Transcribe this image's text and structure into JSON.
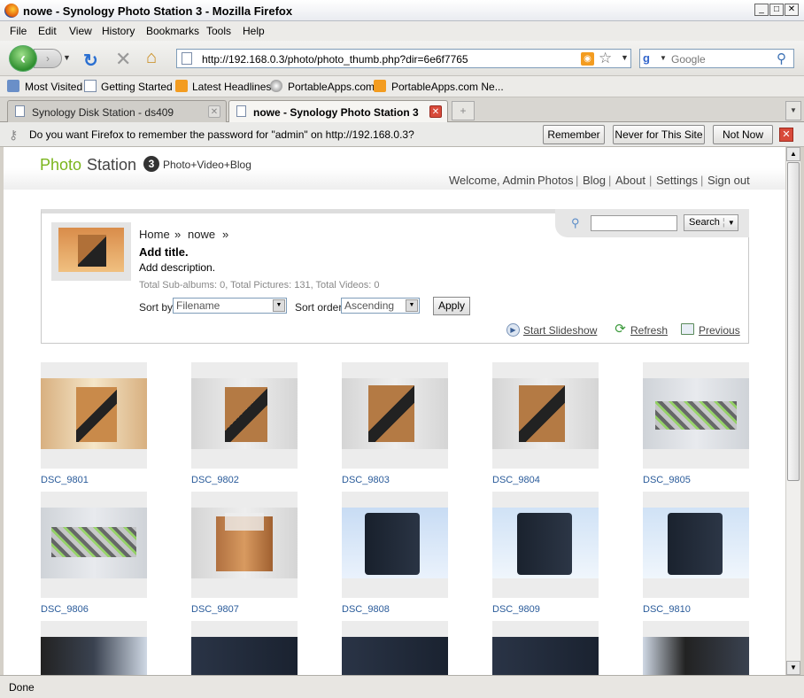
{
  "window": {
    "title": "nowe - Synology Photo Station 3 - Mozilla Firefox",
    "minimize": "_",
    "maximize": "□",
    "close": "✕"
  },
  "menu": [
    "File",
    "Edit",
    "View",
    "History",
    "Bookmarks",
    "Tools",
    "Help"
  ],
  "nav": {
    "url": "http://192.168.0.3/photo/photo_thumb.php?dir=6e6f7765",
    "search_placeholder": "Google"
  },
  "bookmarks": [
    "Most Visited",
    "Getting Started",
    "Latest Headlines",
    "PortableApps.com",
    "PortableApps.com Ne..."
  ],
  "tabs": [
    {
      "label": "Synology Disk Station - ds409"
    },
    {
      "label": "nowe - Synology Photo Station 3"
    }
  ],
  "notification": {
    "message": "Do you want Firefox to remember the password for \"admin\" on http://192.168.0.3?",
    "remember": "Remember",
    "never": "Never for This Site",
    "not_now": "Not Now"
  },
  "site": {
    "logo_photo": "Photo",
    "logo_station": "Station",
    "logo_version": "3",
    "logo_tagline": "Photo+Video+Blog",
    "nav_welcome": "Welcome, Admin",
    "nav_photos": "Photos",
    "nav_blog": "Blog",
    "nav_about": "About",
    "nav_settings": "Settings",
    "nav_signout": "Sign out",
    "search_button": "Search"
  },
  "album": {
    "crumb_home": "Home",
    "crumb_sep": "»",
    "crumb_album": "nowe",
    "title": "Add title.",
    "description": "Add description.",
    "totals": "Total Sub-albums: 0, Total Pictures: 131, Total Videos: 0",
    "sort_by_label": "Sort by",
    "sort_by_value": "Filename",
    "sort_order_label": "Sort order",
    "sort_order_value": "Ascending",
    "apply": "Apply",
    "slideshow": "Start Slideshow",
    "refresh": "Refresh",
    "previous": "Previous"
  },
  "photos": [
    {
      "name": "DSC_9801",
      "kind": "box-warm"
    },
    {
      "name": "DSC_9802",
      "kind": "box"
    },
    {
      "name": "DSC_9803",
      "kind": "box"
    },
    {
      "name": "DSC_9804",
      "kind": "box"
    },
    {
      "name": "DSC_9805",
      "kind": "cables"
    },
    {
      "name": "DSC_9806",
      "kind": "cables"
    },
    {
      "name": "DSC_9807",
      "kind": "packing"
    },
    {
      "name": "DSC_9808",
      "kind": "nas"
    },
    {
      "name": "DSC_9809",
      "kind": "nas"
    },
    {
      "name": "DSC_9810",
      "kind": "nas"
    }
  ],
  "status": "Done"
}
